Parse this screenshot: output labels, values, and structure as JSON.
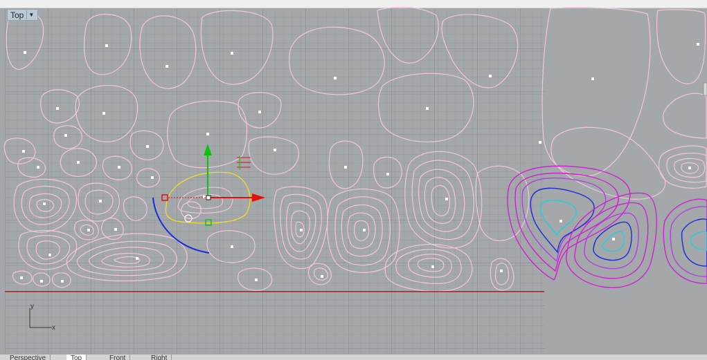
{
  "viewport": {
    "name": "Top",
    "dropdown_icon": "triangle-down-icon"
  },
  "axis_indicator": {
    "x_label": "x",
    "y_label": "y"
  },
  "tabs": [
    {
      "label": "Perspective",
      "active": false
    },
    {
      "label": "Top",
      "active": true
    },
    {
      "label": "Front",
      "active": false
    },
    {
      "label": "Right",
      "active": false
    }
  ],
  "colors": {
    "viewport_bg": "#a4a8ab",
    "grid_minor": "#9a9ea1",
    "grid_major": "#8a8d90",
    "contour": "#f3c6dd",
    "selected_curve": "#f0e020",
    "gumball_x": "#e01010",
    "gumball_y": "#10c010",
    "curve_blue": "#1a2ad8",
    "contour_magenta": "#d020d0",
    "contour_cyan": "#20d0e0",
    "x_axis_line": "#a02020"
  }
}
